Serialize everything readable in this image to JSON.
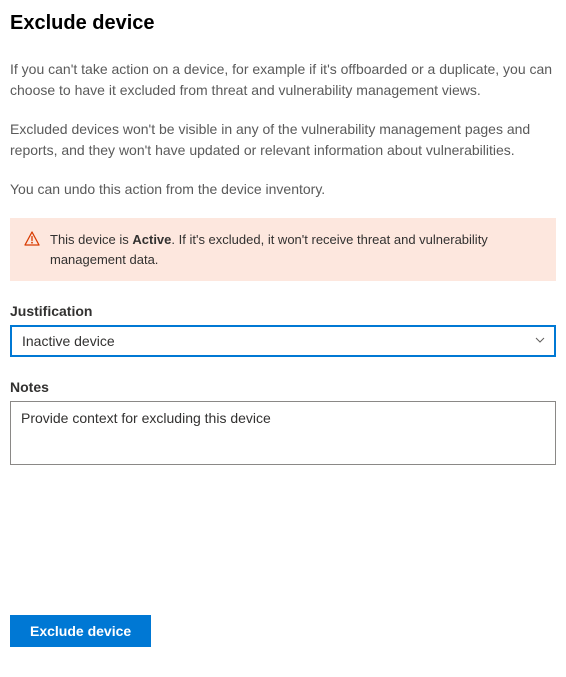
{
  "heading": "Exclude device",
  "paragraphs": [
    "If you can't take action on a device, for example if it's offboarded or a duplicate, you can choose to have it excluded from threat and vulnerability management views.",
    "Excluded devices won't be visible in any of the vulnerability management pages and reports, and they won't have updated or relevant information about vulnerabilities.",
    "You can undo this action from the device inventory."
  ],
  "alert": {
    "prefix": "This device is ",
    "boldWord": "Active",
    "suffix": ". If it's excluded, it won't receive threat and vulnerability management data."
  },
  "justification": {
    "label": "Justification",
    "selected": "Inactive device"
  },
  "notes": {
    "label": "Notes",
    "placeholder": "Provide context for excluding this device",
    "value": ""
  },
  "submit": {
    "label": "Exclude device"
  }
}
